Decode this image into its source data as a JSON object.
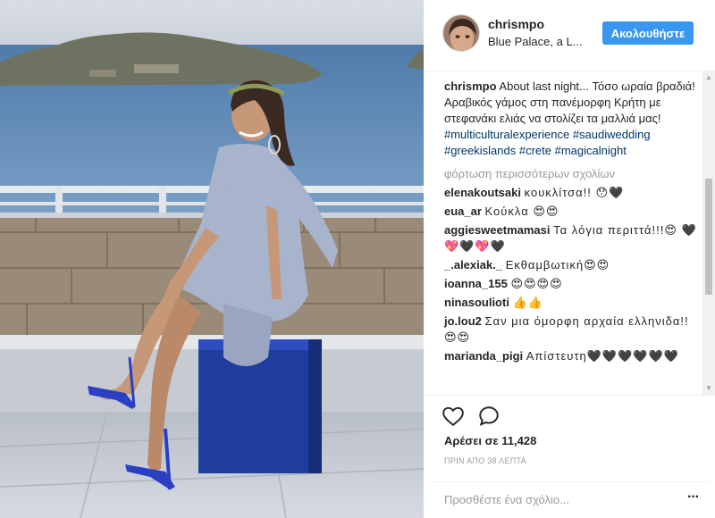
{
  "post": {
    "username": "chrismpo",
    "location": "Blue Palace, a L...",
    "follow_label": "Ακολουθήστε"
  },
  "caption": {
    "username": "chrismpo",
    "text": "About last night... Τόσο ωραία βραδιά! Αραβικός γάμος στη πανέμορφη Κρήτη με στεφανάκι ελιάς να στολίζει τα μαλλιά μας!",
    "hashtags": [
      "#multiculturalexperience",
      "#saudiwedding",
      "#greekislands",
      "#crete",
      "#magicalnight"
    ]
  },
  "load_more_label": "φόρτωση περισσότερων σχολίων",
  "comments": [
    {
      "username": "elenakoutsaki",
      "text": "κουκλίτσα!! 😯🖤"
    },
    {
      "username": "eua_ar",
      "text": "Κούκλα 😍😍"
    },
    {
      "username": "aggiesweetmamasi",
      "text": "Τα λόγια περιττά!!!😍 🖤💖🖤💖🖤"
    },
    {
      "username": "_.alexiak._",
      "text": "Εκθαμβωτική😍😍"
    },
    {
      "username": "ioanna_155",
      "text": "😍😍😍😍"
    },
    {
      "username": "ninasoulioti",
      "text": "👍👍"
    },
    {
      "username": "jo.lou2",
      "text": "Σαν μια όμορφη αρχαία ελληνιδα!! 😍😍"
    },
    {
      "username": "marianda_pigi",
      "text": "Απίστευτη🖤🖤🖤🖤🖤🖤"
    }
  ],
  "likes_text": "Αρέσει σε 11,428",
  "time_ago": "ΠΡΙΝ ΑΠΟ 38 ΛΕΠΤΑ",
  "add_comment_placeholder": "Προσθέστε ένα σχόλιο...",
  "more_options_label": "···",
  "icons": {
    "like": "heart-icon",
    "comment": "comment-bubble-icon",
    "more": "more-options-icon"
  },
  "colors": {
    "follow_button": "#3897f0",
    "hashtag": "#003569",
    "muted": "#999999",
    "sea": "#5f87b3",
    "dress": "#a8b3cc",
    "stool": "#1f3d9c"
  }
}
